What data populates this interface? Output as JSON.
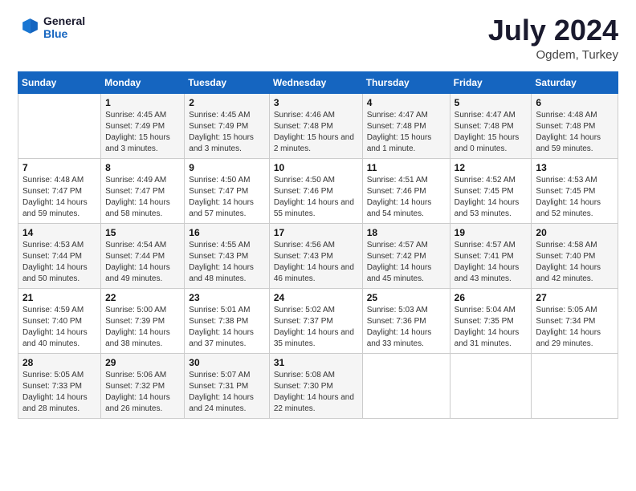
{
  "header": {
    "logo_line1": "General",
    "logo_line2": "Blue",
    "month": "July 2024",
    "location": "Ogdem, Turkey"
  },
  "days_of_week": [
    "Sunday",
    "Monday",
    "Tuesday",
    "Wednesday",
    "Thursday",
    "Friday",
    "Saturday"
  ],
  "weeks": [
    [
      {
        "num": "",
        "sunrise": "",
        "sunset": "",
        "daylight": ""
      },
      {
        "num": "1",
        "sunrise": "Sunrise: 4:45 AM",
        "sunset": "Sunset: 7:49 PM",
        "daylight": "Daylight: 15 hours and 3 minutes."
      },
      {
        "num": "2",
        "sunrise": "Sunrise: 4:45 AM",
        "sunset": "Sunset: 7:49 PM",
        "daylight": "Daylight: 15 hours and 3 minutes."
      },
      {
        "num": "3",
        "sunrise": "Sunrise: 4:46 AM",
        "sunset": "Sunset: 7:48 PM",
        "daylight": "Daylight: 15 hours and 2 minutes."
      },
      {
        "num": "4",
        "sunrise": "Sunrise: 4:47 AM",
        "sunset": "Sunset: 7:48 PM",
        "daylight": "Daylight: 15 hours and 1 minute."
      },
      {
        "num": "5",
        "sunrise": "Sunrise: 4:47 AM",
        "sunset": "Sunset: 7:48 PM",
        "daylight": "Daylight: 15 hours and 0 minutes."
      },
      {
        "num": "6",
        "sunrise": "Sunrise: 4:48 AM",
        "sunset": "Sunset: 7:48 PM",
        "daylight": "Daylight: 14 hours and 59 minutes."
      }
    ],
    [
      {
        "num": "7",
        "sunrise": "Sunrise: 4:48 AM",
        "sunset": "Sunset: 7:47 PM",
        "daylight": "Daylight: 14 hours and 59 minutes."
      },
      {
        "num": "8",
        "sunrise": "Sunrise: 4:49 AM",
        "sunset": "Sunset: 7:47 PM",
        "daylight": "Daylight: 14 hours and 58 minutes."
      },
      {
        "num": "9",
        "sunrise": "Sunrise: 4:50 AM",
        "sunset": "Sunset: 7:47 PM",
        "daylight": "Daylight: 14 hours and 57 minutes."
      },
      {
        "num": "10",
        "sunrise": "Sunrise: 4:50 AM",
        "sunset": "Sunset: 7:46 PM",
        "daylight": "Daylight: 14 hours and 55 minutes."
      },
      {
        "num": "11",
        "sunrise": "Sunrise: 4:51 AM",
        "sunset": "Sunset: 7:46 PM",
        "daylight": "Daylight: 14 hours and 54 minutes."
      },
      {
        "num": "12",
        "sunrise": "Sunrise: 4:52 AM",
        "sunset": "Sunset: 7:45 PM",
        "daylight": "Daylight: 14 hours and 53 minutes."
      },
      {
        "num": "13",
        "sunrise": "Sunrise: 4:53 AM",
        "sunset": "Sunset: 7:45 PM",
        "daylight": "Daylight: 14 hours and 52 minutes."
      }
    ],
    [
      {
        "num": "14",
        "sunrise": "Sunrise: 4:53 AM",
        "sunset": "Sunset: 7:44 PM",
        "daylight": "Daylight: 14 hours and 50 minutes."
      },
      {
        "num": "15",
        "sunrise": "Sunrise: 4:54 AM",
        "sunset": "Sunset: 7:44 PM",
        "daylight": "Daylight: 14 hours and 49 minutes."
      },
      {
        "num": "16",
        "sunrise": "Sunrise: 4:55 AM",
        "sunset": "Sunset: 7:43 PM",
        "daylight": "Daylight: 14 hours and 48 minutes."
      },
      {
        "num": "17",
        "sunrise": "Sunrise: 4:56 AM",
        "sunset": "Sunset: 7:43 PM",
        "daylight": "Daylight: 14 hours and 46 minutes."
      },
      {
        "num": "18",
        "sunrise": "Sunrise: 4:57 AM",
        "sunset": "Sunset: 7:42 PM",
        "daylight": "Daylight: 14 hours and 45 minutes."
      },
      {
        "num": "19",
        "sunrise": "Sunrise: 4:57 AM",
        "sunset": "Sunset: 7:41 PM",
        "daylight": "Daylight: 14 hours and 43 minutes."
      },
      {
        "num": "20",
        "sunrise": "Sunrise: 4:58 AM",
        "sunset": "Sunset: 7:40 PM",
        "daylight": "Daylight: 14 hours and 42 minutes."
      }
    ],
    [
      {
        "num": "21",
        "sunrise": "Sunrise: 4:59 AM",
        "sunset": "Sunset: 7:40 PM",
        "daylight": "Daylight: 14 hours and 40 minutes."
      },
      {
        "num": "22",
        "sunrise": "Sunrise: 5:00 AM",
        "sunset": "Sunset: 7:39 PM",
        "daylight": "Daylight: 14 hours and 38 minutes."
      },
      {
        "num": "23",
        "sunrise": "Sunrise: 5:01 AM",
        "sunset": "Sunset: 7:38 PM",
        "daylight": "Daylight: 14 hours and 37 minutes."
      },
      {
        "num": "24",
        "sunrise": "Sunrise: 5:02 AM",
        "sunset": "Sunset: 7:37 PM",
        "daylight": "Daylight: 14 hours and 35 minutes."
      },
      {
        "num": "25",
        "sunrise": "Sunrise: 5:03 AM",
        "sunset": "Sunset: 7:36 PM",
        "daylight": "Daylight: 14 hours and 33 minutes."
      },
      {
        "num": "26",
        "sunrise": "Sunrise: 5:04 AM",
        "sunset": "Sunset: 7:35 PM",
        "daylight": "Daylight: 14 hours and 31 minutes."
      },
      {
        "num": "27",
        "sunrise": "Sunrise: 5:05 AM",
        "sunset": "Sunset: 7:34 PM",
        "daylight": "Daylight: 14 hours and 29 minutes."
      }
    ],
    [
      {
        "num": "28",
        "sunrise": "Sunrise: 5:05 AM",
        "sunset": "Sunset: 7:33 PM",
        "daylight": "Daylight: 14 hours and 28 minutes."
      },
      {
        "num": "29",
        "sunrise": "Sunrise: 5:06 AM",
        "sunset": "Sunset: 7:32 PM",
        "daylight": "Daylight: 14 hours and 26 minutes."
      },
      {
        "num": "30",
        "sunrise": "Sunrise: 5:07 AM",
        "sunset": "Sunset: 7:31 PM",
        "daylight": "Daylight: 14 hours and 24 minutes."
      },
      {
        "num": "31",
        "sunrise": "Sunrise: 5:08 AM",
        "sunset": "Sunset: 7:30 PM",
        "daylight": "Daylight: 14 hours and 22 minutes."
      },
      {
        "num": "",
        "sunrise": "",
        "sunset": "",
        "daylight": ""
      },
      {
        "num": "",
        "sunrise": "",
        "sunset": "",
        "daylight": ""
      },
      {
        "num": "",
        "sunrise": "",
        "sunset": "",
        "daylight": ""
      }
    ]
  ]
}
